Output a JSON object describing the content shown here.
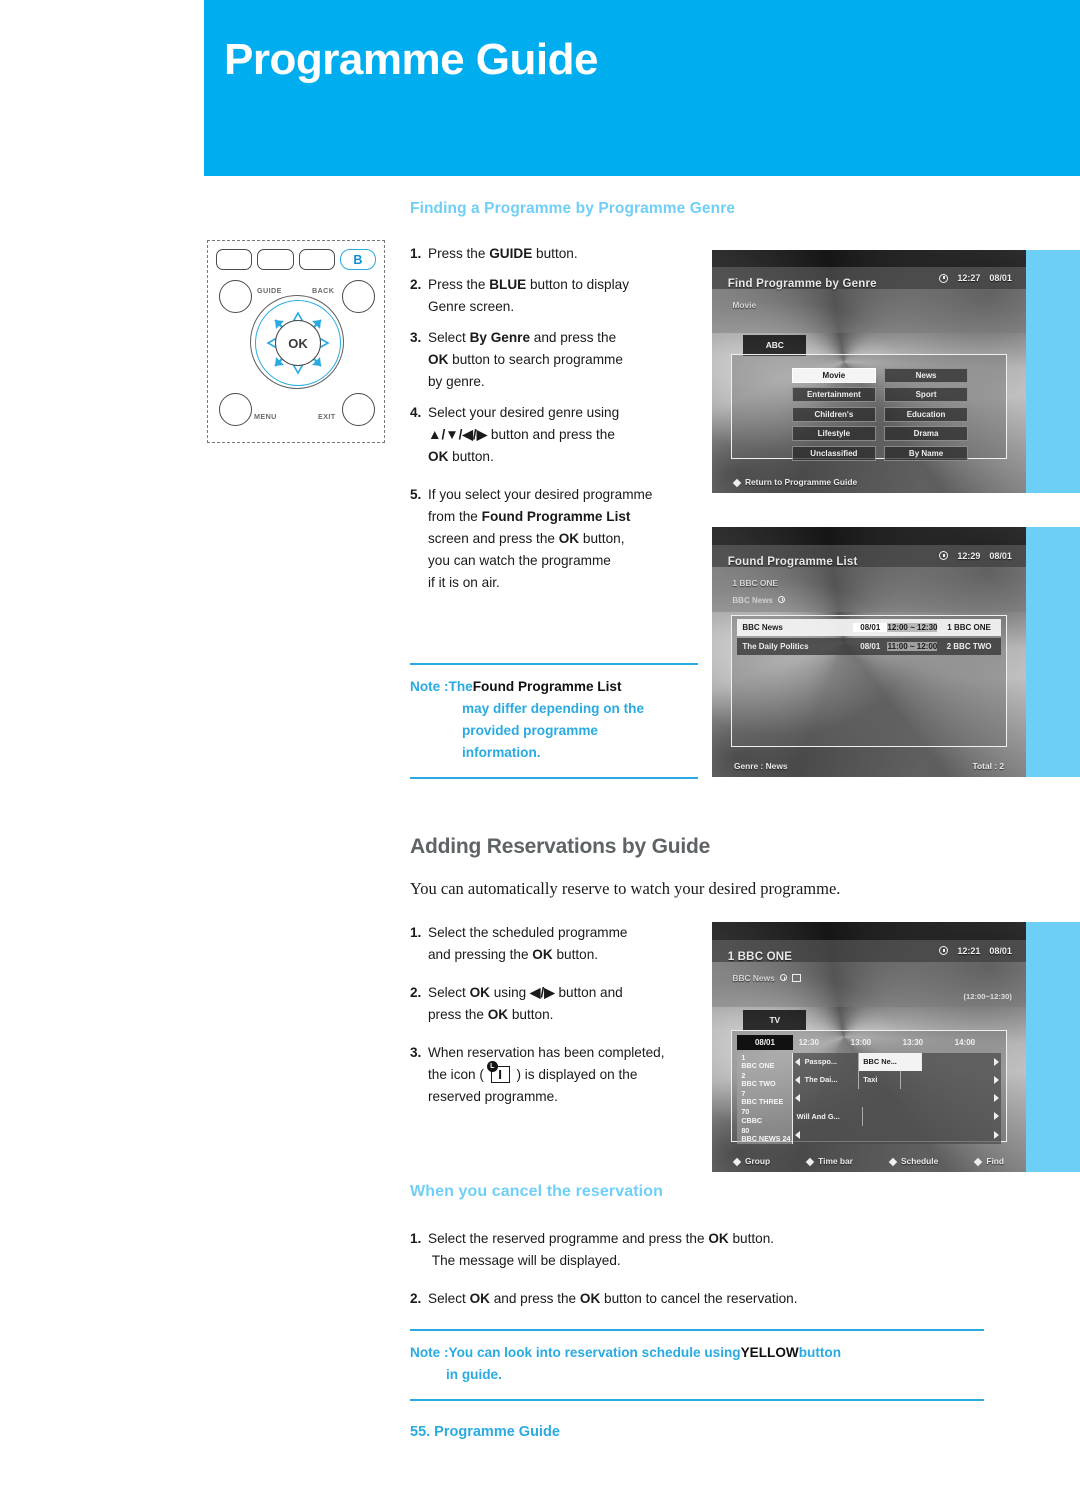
{
  "banner": {
    "title": "Programme Guide"
  },
  "section1": {
    "heading": "Finding a Programme by Programme Genre",
    "steps": [
      {
        "num": "1.",
        "html": "Press the <b>GUIDE</b> button."
      },
      {
        "num": "2.",
        "html": "Press the <b>BLUE</b> button to display<br>Genre screen."
      },
      {
        "num": "3.",
        "html": "Select <b>By Genre</b> and press the<br><b>OK</b> button to search programme<br>by genre."
      },
      {
        "num": "4.",
        "html": "Select your desired genre using<br><b>&#9650;/&#9660;/&#9664;/&#9654;</b> button and press the<br><b>OK</b> button."
      },
      {
        "num": "5.",
        "html": "If you select your desired programme<br>from the <b>Found Programme List</b><br>screen and press the <b>OK</b> button,<br>you can watch the programme<br>if it is on air."
      }
    ],
    "note": {
      "label": "Note : ",
      "lead": "The ",
      "bold": "Found Programme List",
      "rest": [
        "may differ depending on the",
        "provided programme",
        "information."
      ]
    }
  },
  "section2": {
    "heading": "Adding Reservations by Guide",
    "intro": "You can automatically reserve to watch your desired programme.",
    "steps": [
      {
        "num": "1.",
        "html": "Select the scheduled programme<br>and pressing the <b>OK</b> button."
      },
      {
        "num": "2.",
        "html": "Select <b>OK</b> using <b>&#9664;/&#9654;</b> button and<br>press the <b>OK</b> button."
      },
      {
        "num": "3.",
        "html": "When reservation has been completed,<br>the icon ( <span class=\"res-icon\"><span class=\"dot\">L</span><span class=\"bar\"></span></span> ) is displayed on the<br>reserved programme."
      }
    ]
  },
  "section3": {
    "heading": "When you cancel the reservation",
    "steps": [
      {
        "num": "1.",
        "html": "Select the reserved programme and press the <b>OK</b> button.<br>&nbsp;The message will be displayed."
      },
      {
        "num": "2.",
        "html": "Select <b>OK</b> and press the <b>OK</b> button to cancel the reservation."
      }
    ],
    "note": {
      "label": "Note : ",
      "lead": "You can look into reservation schedule using ",
      "bold": "YELLOW",
      "after": " button",
      "rest": [
        "in guide."
      ]
    }
  },
  "footer": {
    "text": "55. Programme Guide"
  },
  "remote": {
    "button_b": "B",
    "labels": {
      "guide": "GUIDE",
      "back": "BACK",
      "menu": "MENU",
      "exit": "EXIT",
      "ok": "OK"
    }
  },
  "tv_screens": [
    {
      "title": "Find Programme by Genre",
      "subtitle": "Movie",
      "time": "12:27",
      "date": "08/01",
      "tab": "ABC",
      "genres_left": [
        "Movie",
        "Entertainment",
        "Children's",
        "Lifestyle",
        "Unclassified"
      ],
      "genres_right": [
        "News",
        "Sport",
        "Education",
        "Drama",
        "By Name"
      ],
      "selected_genre": "Movie",
      "footer": "Return to Programme Guide"
    },
    {
      "title": "Found Programme List",
      "subtitle": "1 BBC ONE",
      "subtitle2": "BBC News",
      "time": "12:29",
      "date": "08/01",
      "rows": [
        {
          "name": "BBC News",
          "date": "08/01",
          "time": "12:00 ~ 12:30",
          "channel": "1 BBC ONE"
        },
        {
          "name": "The Daily Politics",
          "date": "08/01",
          "time": "11:00 ~ 12:00",
          "channel": "2 BBC TWO"
        }
      ],
      "footer_left": "Genre : News",
      "footer_right": "Total : 2"
    },
    {
      "title": "1 BBC ONE",
      "subtitle": "BBC News",
      "time": "12:21",
      "date": "08/01",
      "range": "(12:00~12:30)",
      "tab": "TV",
      "grid_date": "08/01",
      "time_cols": [
        "12:30",
        "13:00",
        "13:30",
        "14:00"
      ],
      "channels": [
        {
          "num": "1",
          "name": "BBC ONE"
        },
        {
          "num": "2",
          "name": "BBC TWO"
        },
        {
          "num": "7",
          "name": "BBC THREE"
        },
        {
          "num": "70",
          "name": "CBBC"
        },
        {
          "num": "80",
          "name": "BBC NEWS 24"
        }
      ],
      "programmes": [
        [
          "Passpo...",
          "BBC Ne..."
        ],
        [
          "The Dai...",
          "Taxi"
        ],
        [],
        [
          "Will And G..."
        ],
        []
      ],
      "footer_items": [
        "Group",
        "Time bar",
        "Schedule",
        "Find"
      ]
    }
  ],
  "colors": {
    "banner": "#00aeef",
    "heading_cyan": "#6fcff6",
    "heading_gray": "#5e6366",
    "note_cyan": "#29abe2",
    "tv_side": "#6dcff6"
  }
}
